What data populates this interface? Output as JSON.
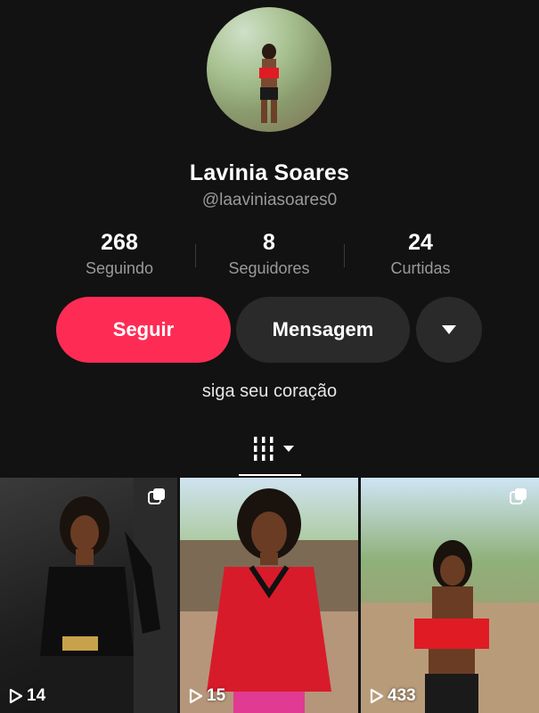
{
  "profile": {
    "display_name": "Lavinia Soares",
    "username": "@laaviniasoares0",
    "bio": "siga seu coração"
  },
  "stats": [
    {
      "value": "268",
      "label": "Seguindo"
    },
    {
      "value": "8",
      "label": "Seguidores"
    },
    {
      "value": "24",
      "label": "Curtidas"
    }
  ],
  "actions": {
    "follow_label": "Seguir",
    "message_label": "Mensagem",
    "more_icon": "caret-down-icon"
  },
  "colors": {
    "follow_button": "#fe2c55",
    "background": "#121212",
    "secondary_button": "#2a2a2a"
  },
  "tabs": {
    "active_icon": "videos-grid-icon"
  },
  "videos": [
    {
      "views": "14"
    },
    {
      "views": "15"
    },
    {
      "views": "433"
    }
  ]
}
